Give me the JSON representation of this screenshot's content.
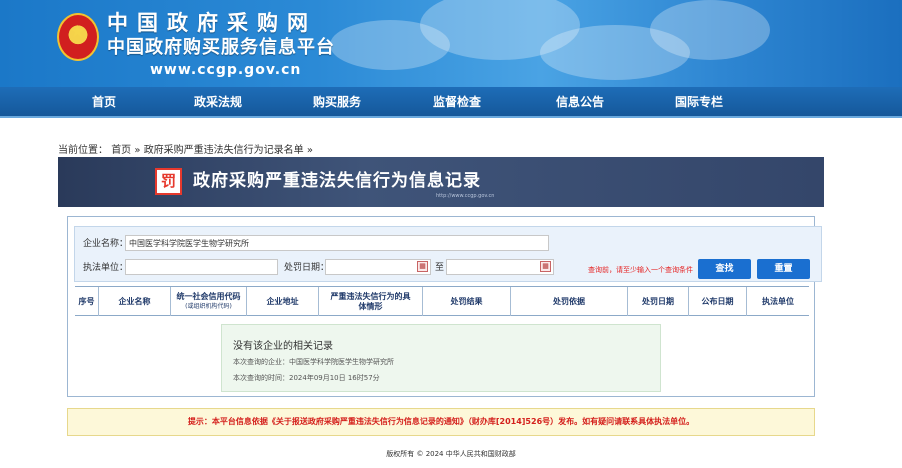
{
  "header": {
    "logo_title": "中国政府采购网",
    "logo_subtitle": "中国政府购买服务信息平台",
    "logo_url": "www.ccgp.gov.cn"
  },
  "nav": {
    "items": [
      "首页",
      "政采法规",
      "购买服务",
      "监督检查",
      "信息公告",
      "国际专栏"
    ]
  },
  "breadcrumb": {
    "prefix": "当前位置：",
    "home": "首页",
    "sep": "»",
    "current": "政府采购严重违法失信行为记录名单",
    "tail": "»"
  },
  "banner": {
    "icon_glyph": "罚",
    "title": "政府采购严重违法失信行为信息记录",
    "url": "http://www.ccgp.gov.cn"
  },
  "search": {
    "company_label": "企业名称：",
    "company_value": "中国医学科学院医学生物学研究所",
    "agency_label": "执法单位：",
    "agency_value": "",
    "date_label": "处罚日期：",
    "date_to_label": "至",
    "date_from_value": "",
    "date_to_value": "",
    "hint": "查询前，请至少输入一个查询条件",
    "query_button": "查找",
    "reset_button": "重置"
  },
  "table": {
    "columns": [
      "序号",
      "企业名称",
      "统一社会信用代码",
      "企业地址",
      "严重违法失信行为的具体情形",
      "处罚结果",
      "处罚依据",
      "处罚日期",
      "公布日期",
      "执法单位"
    ],
    "credit_code_note": "(或组织机构代码)"
  },
  "no_result": {
    "title": "没有该企业的相关记录",
    "company_line": "本次查询的企业：中国医学科学院医学生物学研究所",
    "time_line": "本次查询的时间：2024年09月10日 16时57分"
  },
  "notice": "提示：本平台信息依据《关于报送政府采购严重违法失信行为信息记录的通知》（财办库[2014]526号）发布。如有疑问请联系具体执法单位。",
  "footer": "版权所有 © 2024 中华人民共和国财政部"
}
